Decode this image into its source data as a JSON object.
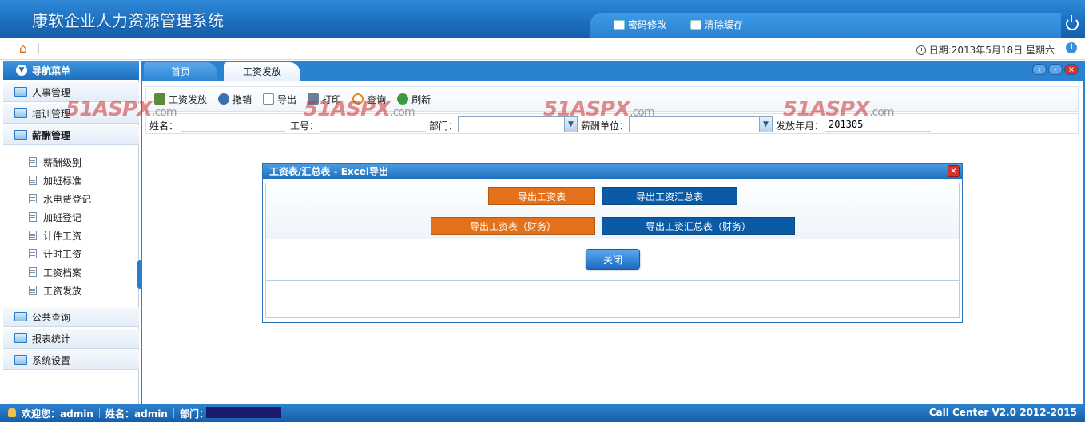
{
  "app": {
    "title": "康软企业人力资源管理系统",
    "top_links": {
      "password": "密码修改",
      "clear_cache": "清除缓存"
    },
    "date_text": "日期:2013年5月18日  星期六"
  },
  "sidebar": {
    "header": "导航菜单",
    "groups": [
      {
        "label": "人事管理"
      },
      {
        "label": "培训管理"
      },
      {
        "label": "薪酬管理"
      },
      {
        "label": "公共查询"
      },
      {
        "label": "报表统计"
      },
      {
        "label": "系统设置"
      }
    ],
    "items": [
      {
        "label": "薪酬级别"
      },
      {
        "label": "加班标准"
      },
      {
        "label": "水电费登记"
      },
      {
        "label": "加班登记"
      },
      {
        "label": "计件工资"
      },
      {
        "label": "计时工资"
      },
      {
        "label": "工资档案"
      },
      {
        "label": "工资发放"
      }
    ]
  },
  "tabs": {
    "home": "首页",
    "active": "工资发放"
  },
  "toolbar": {
    "issue": "工资发放",
    "revoke": "撤销",
    "export": "导出",
    "print": "打印",
    "query": "查询",
    "refresh": "刷新"
  },
  "search": {
    "name_label": "姓名：",
    "name_value": "",
    "emp_no_label": "工号：",
    "emp_no_value": "",
    "dept_label": "部门：",
    "dept_value": "",
    "unit_label": "薪酬单位：",
    "unit_value": "",
    "month_label": "发放年月：",
    "month_value": "201305"
  },
  "dialog": {
    "title": "工资表/汇总表 - Excel导出",
    "btn_salary": "导出工资表",
    "btn_summary": "导出工资汇总表",
    "btn_salary_fin": "导出工资表（财务）",
    "btn_summary_fin": "导出工资汇总表（财务）",
    "close": "关闭"
  },
  "watermark": {
    "brand": "51ASPX",
    "suffix": ".com"
  },
  "status": {
    "welcome": "欢迎您：admin",
    "name": "姓名：admin",
    "dept": "部门：",
    "version": "Call Center V2.0",
    "years": "2012-2015"
  },
  "colors": {
    "primary_blue": "#2a82d0",
    "orange_button": "#e3701a",
    "blue_button": "#0b5aa6",
    "close_red": "#d9302a"
  }
}
